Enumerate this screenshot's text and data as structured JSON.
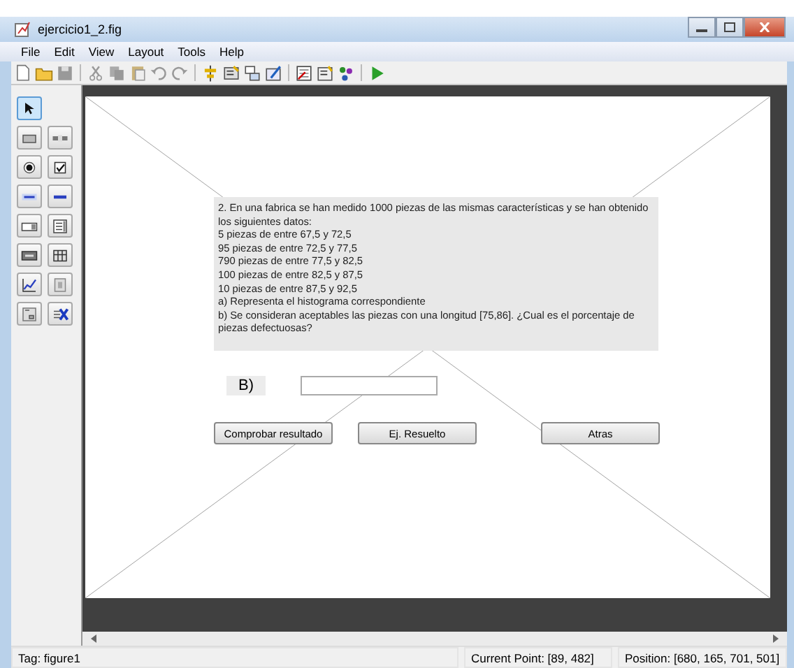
{
  "window": {
    "title": "ejercicio1_2.fig"
  },
  "menu": [
    "File",
    "Edit",
    "View",
    "Layout",
    "Tools",
    "Help"
  ],
  "toolbar": [
    {
      "kind": "new"
    },
    {
      "kind": "open"
    },
    {
      "kind": "save"
    },
    {
      "kind": "sep"
    },
    {
      "kind": "cut"
    },
    {
      "kind": "copy"
    },
    {
      "kind": "paste"
    },
    {
      "kind": "undo"
    },
    {
      "kind": "redo"
    },
    {
      "kind": "sep"
    },
    {
      "kind": "align"
    },
    {
      "kind": "menu"
    },
    {
      "kind": "taborder"
    },
    {
      "kind": "mfile"
    },
    {
      "kind": "sep"
    },
    {
      "kind": "inspector"
    },
    {
      "kind": "browser"
    },
    {
      "kind": "objects"
    },
    {
      "kind": "sep"
    },
    {
      "kind": "run"
    }
  ],
  "palette": [
    {
      "kind": "pointer",
      "selected": true
    },
    {
      "kind": "pushbutton",
      "selected": false
    },
    {
      "kind": "slider",
      "selected": false
    },
    {
      "kind": "radio",
      "selected": false
    },
    {
      "kind": "checkbox",
      "selected": false
    },
    {
      "kind": "edit",
      "selected": false
    },
    {
      "kind": "text",
      "selected": false
    },
    {
      "kind": "popup",
      "selected": false
    },
    {
      "kind": "listbox",
      "selected": false
    },
    {
      "kind": "toggle",
      "selected": false
    },
    {
      "kind": "table",
      "selected": false
    },
    {
      "kind": "axes",
      "selected": false
    },
    {
      "kind": "panel",
      "selected": false
    },
    {
      "kind": "buttongroup",
      "selected": false
    },
    {
      "kind": "activex",
      "selected": false
    }
  ],
  "figure": {
    "question": [
      "2. En una fabrica se han medido 1000 piezas de las mismas características y se han obtenido los siguientes datos:",
      "5 piezas de entre 67,5 y 72,5",
      "95 piezas de entre 72,5 y 77,5",
      "790 piezas de entre 77,5 y 82,5",
      "100 piezas de entre 82,5 y 87,5",
      "10 piezas de entre 87,5 y 92,5",
      "a) Representa el histograma correspondiente",
      "b) Se consideran aceptables las piezas con una longitud [75,86]. ¿Cual es el porcentaje de piezas defectuosas?"
    ],
    "answer_label": "B)",
    "buttons": [
      "Comprobar resultado",
      "Ej. Resuelto",
      "Atras"
    ]
  },
  "status_bar": {
    "tag": "Tag: figure1",
    "current_point": "Current Point:  [89, 482]",
    "position": "Position: [680, 165, 701, 501]"
  }
}
